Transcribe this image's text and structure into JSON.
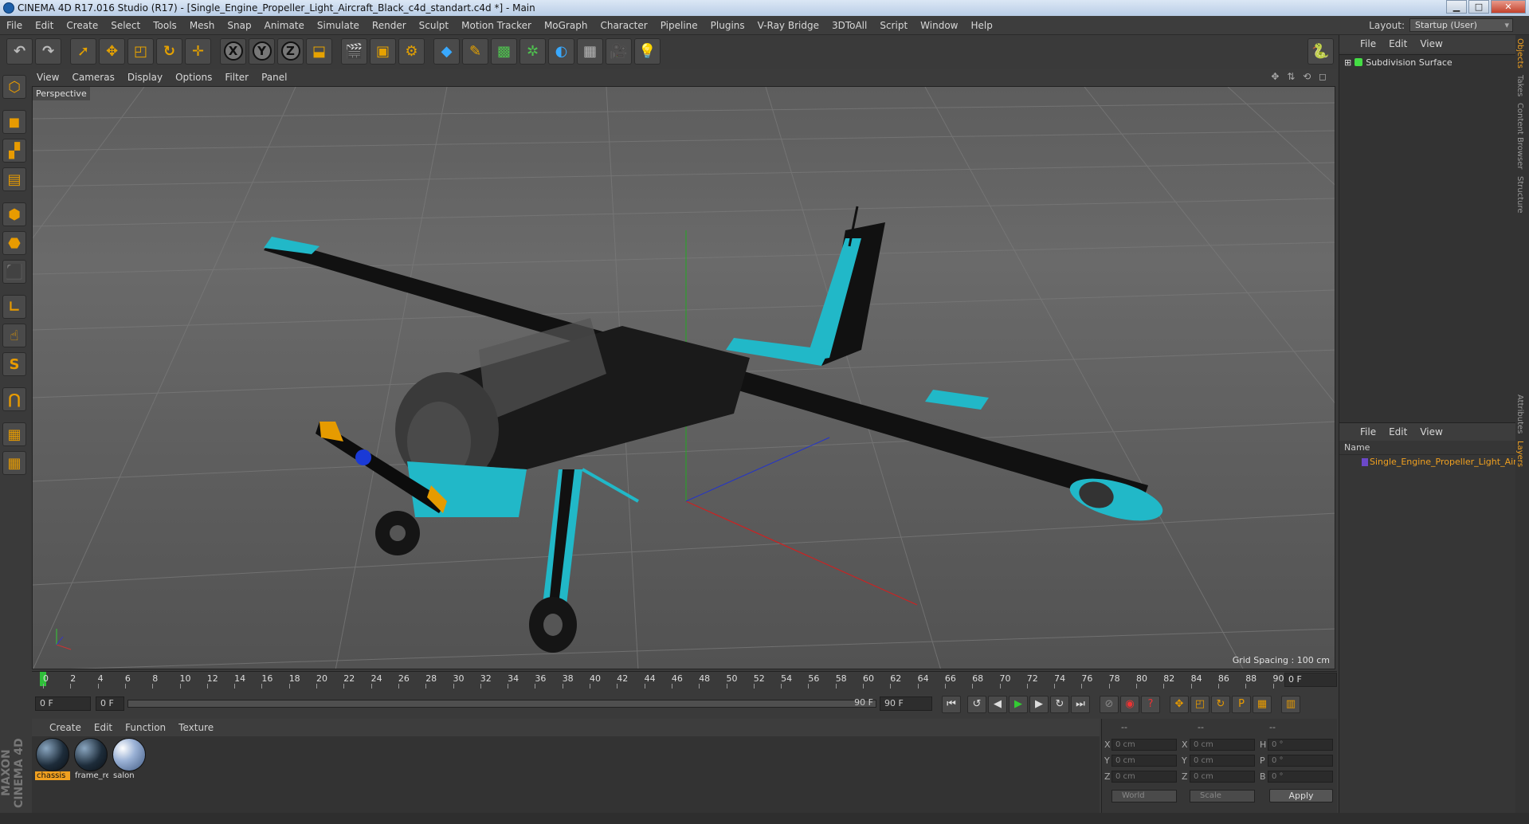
{
  "window": {
    "title": "CINEMA 4D R17.016 Studio (R17) - [Single_Engine_Propeller_Light_Aircraft_Black_c4d_standart.c4d *] - Main",
    "min": "▁",
    "max": "□",
    "close": "✕"
  },
  "menubar": {
    "items": [
      "File",
      "Edit",
      "Create",
      "Select",
      "Tools",
      "Mesh",
      "Snap",
      "Animate",
      "Simulate",
      "Render",
      "Sculpt",
      "Motion Tracker",
      "MoGraph",
      "Character",
      "Pipeline",
      "Plugins",
      "V-Ray Bridge",
      "3DToAll",
      "Script",
      "Window",
      "Help"
    ],
    "layout_label": "Layout:",
    "layout_value": "Startup (User)"
  },
  "viewport": {
    "menu": [
      "View",
      "Cameras",
      "Display",
      "Options",
      "Filter",
      "Panel"
    ],
    "camera_label": "Perspective",
    "grid_spacing": "Grid Spacing : 100 cm"
  },
  "objects_panel": {
    "menu": [
      "File",
      "Edit",
      "View"
    ],
    "items": [
      {
        "name": "Subdivision Surface"
      }
    ]
  },
  "layers_panel": {
    "menu": [
      "File",
      "Edit",
      "View"
    ],
    "column": "Name",
    "items": [
      {
        "name": "Single_Engine_Propeller_Light_Air",
        "color": "#6b48c8"
      }
    ]
  },
  "side_tabs": [
    "Objects",
    "Takes",
    "Content Browser",
    "Structure",
    "Attributes",
    "Layers"
  ],
  "timeline": {
    "ticks": [
      "0",
      "2",
      "4",
      "6",
      "8",
      "10",
      "12",
      "14",
      "16",
      "18",
      "20",
      "22",
      "24",
      "26",
      "28",
      "30",
      "32",
      "34",
      "36",
      "38",
      "40",
      "42",
      "44",
      "46",
      "48",
      "50",
      "52",
      "54",
      "56",
      "58",
      "60",
      "62",
      "64",
      "66",
      "68",
      "70",
      "72",
      "74",
      "76",
      "78",
      "80",
      "82",
      "84",
      "86",
      "88",
      "90"
    ],
    "current_frame": "0 F"
  },
  "transport": {
    "start": "0 F",
    "range_start": "0 F",
    "range_end": "90 F",
    "end": "90 F"
  },
  "materials": {
    "menu": [
      "Create",
      "Edit",
      "Function",
      "Texture"
    ],
    "items": [
      {
        "label": "chassis",
        "selected": true
      },
      {
        "label": "frame_re",
        "selected": false
      },
      {
        "label": "salon",
        "selected": false
      }
    ]
  },
  "coordinates": {
    "headers": [
      "--",
      "--",
      "--"
    ],
    "rows": [
      {
        "a": "X",
        "av": "0 cm",
        "b": "X",
        "bv": "0 cm",
        "c": "H",
        "cv": "0 °"
      },
      {
        "a": "Y",
        "av": "0 cm",
        "b": "Y",
        "bv": "0 cm",
        "c": "P",
        "cv": "0 °"
      },
      {
        "a": "Z",
        "av": "0 cm",
        "b": "Z",
        "bv": "0 cm",
        "c": "B",
        "cv": "0 °"
      }
    ],
    "mode1": "World",
    "mode2": "Scale",
    "apply": "Apply"
  },
  "brand": "MAXON CINEMA 4D",
  "colors": {
    "accent": "#f0a020",
    "plane_accent": "#21b8c8",
    "x_axis": "#cc2222",
    "y_axis": "#22aa22",
    "z_axis": "#2233cc"
  }
}
